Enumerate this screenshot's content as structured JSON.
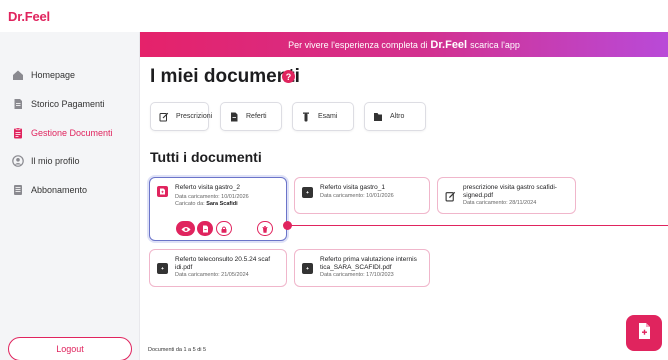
{
  "app": {
    "logo_text": "Dr.Feel",
    "brand_color": "#e0245e"
  },
  "sidebar": {
    "items": [
      {
        "label": "Homepage",
        "icon": "home-icon",
        "active": false
      },
      {
        "label": "Storico Pagamenti",
        "icon": "document-icon",
        "active": false
      },
      {
        "label": "Gestione Documenti",
        "icon": "clipboard-icon",
        "active": true
      },
      {
        "label": "Il mio profilo",
        "icon": "user-icon",
        "active": false
      },
      {
        "label": "Abbonamento",
        "icon": "list-icon",
        "active": false
      }
    ],
    "logout_label": "Logout"
  },
  "banner": {
    "pre": "Per vivere l'esperienza completa di",
    "brand": "Dr.Feel",
    "post": "scarica l'app"
  },
  "main": {
    "title": "I miei documenti",
    "help_glyph": "?",
    "categories": [
      {
        "label": "Prescrizioni",
        "icon": "prescription-icon"
      },
      {
        "label": "Referti",
        "icon": "file-icon"
      },
      {
        "label": "Esami",
        "icon": "test-tube-icon"
      },
      {
        "label": "Altro",
        "icon": "folder-icon"
      }
    ],
    "section_title": "Tutti i documenti",
    "documents": [
      {
        "name": "Referto visita gastro_2",
        "date": "Data caricamento: 10/01/2026",
        "uploaded_by_label": "Caricato da:",
        "uploaded_by": "Sara Scafidi",
        "icon": "file-icon",
        "expanded": true
      },
      {
        "name": "Referto visita gastro_1",
        "date": "Data caricamento: 10/01/2026",
        "icon": "file-icon"
      },
      {
        "name_line1": "prescrizione visita gastro scafidi-",
        "name_line2": "signed.pdf",
        "date": "Data caricamento: 28/11/2024",
        "icon": "prescription-icon"
      },
      {
        "name_line1": "Referto teleconsulto 20.5.24 scaf",
        "name_line2": "idi.pdf",
        "date": "Data caricamento: 21/05/2024",
        "icon": "file-icon"
      },
      {
        "name_line1": "Referto prima valutazione internis",
        "name_line2": "tica_SARA_SCAFIDI.pdf",
        "date": "Data caricamento: 17/10/2023",
        "icon": "file-icon"
      }
    ],
    "actions": [
      "eye-icon",
      "download-icon",
      "lock-icon",
      "trash-icon"
    ]
  },
  "footer": {
    "count_text": "Documenti da 1 a 5 di 5"
  },
  "fab": {
    "icon": "upload-document-icon"
  }
}
